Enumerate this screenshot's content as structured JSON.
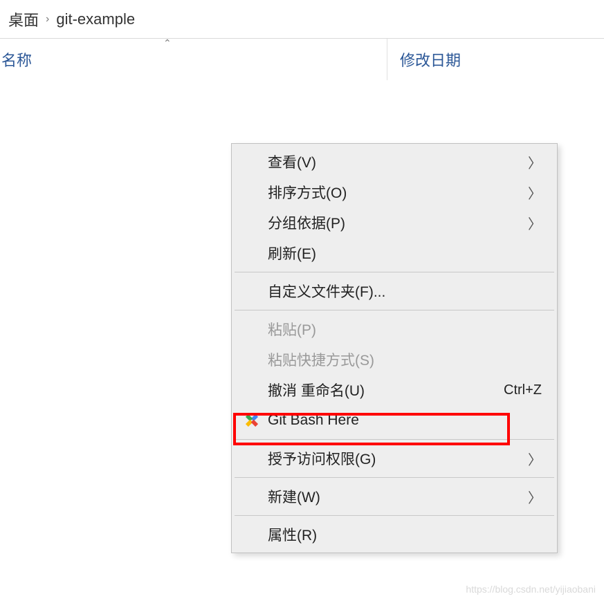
{
  "breadcrumb": {
    "items": [
      "桌面",
      "git-example"
    ],
    "separator": "›"
  },
  "columns": {
    "name": "名称",
    "modified": "修改日期"
  },
  "context_menu": {
    "items": [
      {
        "label": "查看(V)",
        "has_submenu": true,
        "enabled": true
      },
      {
        "label": "排序方式(O)",
        "has_submenu": true,
        "enabled": true
      },
      {
        "label": "分组依据(P)",
        "has_submenu": true,
        "enabled": true
      },
      {
        "label": "刷新(E)",
        "has_submenu": false,
        "enabled": true
      },
      {
        "separator": true
      },
      {
        "label": "自定义文件夹(F)...",
        "has_submenu": false,
        "enabled": true
      },
      {
        "separator": true
      },
      {
        "label": "粘贴(P)",
        "has_submenu": false,
        "enabled": false
      },
      {
        "label": "粘贴快捷方式(S)",
        "has_submenu": false,
        "enabled": false
      },
      {
        "label": "撤消 重命名(U)",
        "has_submenu": false,
        "enabled": true,
        "shortcut": "Ctrl+Z"
      },
      {
        "label": "Git Bash Here",
        "has_submenu": false,
        "enabled": true,
        "icon": "git-icon",
        "highlighted": true
      },
      {
        "separator": true
      },
      {
        "label": "授予访问权限(G)",
        "has_submenu": true,
        "enabled": true
      },
      {
        "separator": true
      },
      {
        "label": "新建(W)",
        "has_submenu": true,
        "enabled": true
      },
      {
        "separator": true
      },
      {
        "label": "属性(R)",
        "has_submenu": false,
        "enabled": true
      }
    ]
  },
  "watermark": "https://blog.csdn.net/yijiaobani"
}
